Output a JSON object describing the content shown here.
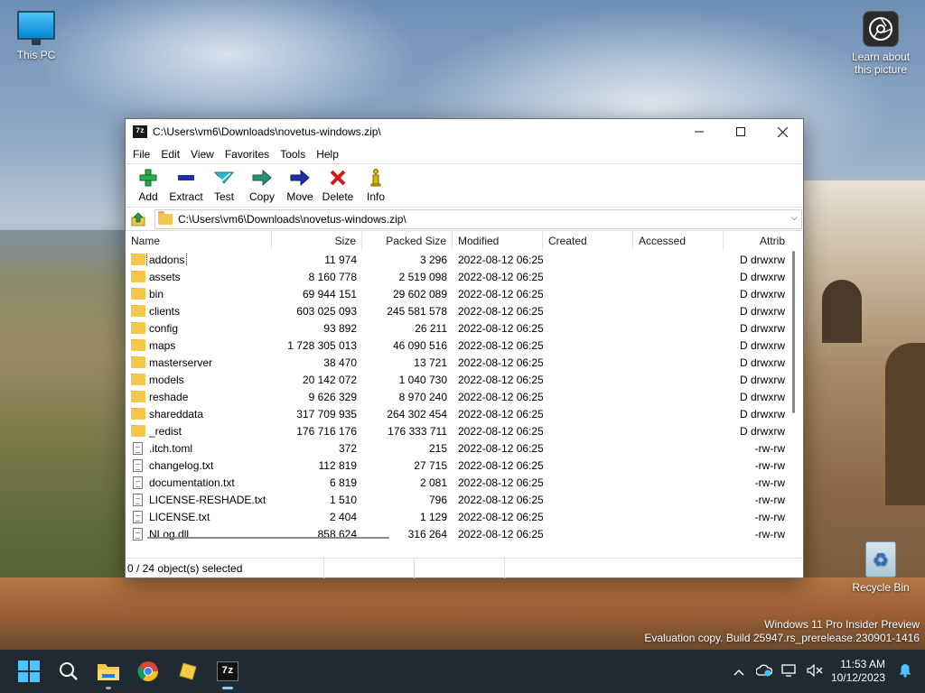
{
  "desktop": {
    "icons": {
      "this_pc": "This PC",
      "learn": "Learn about this picture",
      "recycle": "Recycle Bin"
    },
    "watermark": {
      "line1": "Windows 11 Pro Insider Preview",
      "line2": "Evaluation copy. Build 25947.rs_prerelease.230901-1416"
    }
  },
  "window": {
    "title": "C:\\Users\\vm6\\Downloads\\novetus-windows.zip\\",
    "app_icon_text": "7z",
    "menu": [
      "File",
      "Edit",
      "View",
      "Favorites",
      "Tools",
      "Help"
    ],
    "toolbar": [
      {
        "label": "Add",
        "icon": "add-icon",
        "color": "#22b14c"
      },
      {
        "label": "Extract",
        "icon": "extract-icon",
        "color": "#1d2fa8"
      },
      {
        "label": "Test",
        "icon": "test-icon",
        "color": "#2bb5c8"
      },
      {
        "label": "Copy",
        "icon": "copy-icon",
        "color": "#2b8f7a"
      },
      {
        "label": "Move",
        "icon": "move-icon",
        "color": "#1d2fa8"
      },
      {
        "label": "Delete",
        "icon": "delete-icon",
        "color": "#d01818"
      },
      {
        "label": "Info",
        "icon": "info-icon",
        "color": "#d6b400"
      }
    ],
    "address": "C:\\Users\\vm6\\Downloads\\novetus-windows.zip\\",
    "columns": {
      "name": "Name",
      "size": "Size",
      "packed": "Packed Size",
      "modified": "Modified",
      "created": "Created",
      "accessed": "Accessed",
      "attrib": "Attrib"
    },
    "rows": [
      {
        "name": "addons",
        "type": "folder",
        "size": "11 974",
        "packed": "3 296",
        "modified": "2022-08-12 06:25",
        "created": "",
        "accessed": "",
        "attrib": "D drwxrw"
      },
      {
        "name": "assets",
        "type": "folder",
        "size": "8 160 778",
        "packed": "2 519 098",
        "modified": "2022-08-12 06:25",
        "created": "",
        "accessed": "",
        "attrib": "D drwxrw"
      },
      {
        "name": "bin",
        "type": "folder",
        "size": "69 944 151",
        "packed": "29 602 089",
        "modified": "2022-08-12 06:25",
        "created": "",
        "accessed": "",
        "attrib": "D drwxrw"
      },
      {
        "name": "clients",
        "type": "folder",
        "size": "603 025 093",
        "packed": "245 581 578",
        "modified": "2022-08-12 06:25",
        "created": "",
        "accessed": "",
        "attrib": "D drwxrw"
      },
      {
        "name": "config",
        "type": "folder",
        "size": "93 892",
        "packed": "26 211",
        "modified": "2022-08-12 06:25",
        "created": "",
        "accessed": "",
        "attrib": "D drwxrw"
      },
      {
        "name": "maps",
        "type": "folder",
        "size": "1 728 305 013",
        "packed": "46 090 516",
        "modified": "2022-08-12 06:25",
        "created": "",
        "accessed": "",
        "attrib": "D drwxrw"
      },
      {
        "name": "masterserver",
        "type": "folder",
        "size": "38 470",
        "packed": "13 721",
        "modified": "2022-08-12 06:25",
        "created": "",
        "accessed": "",
        "attrib": "D drwxrw"
      },
      {
        "name": "models",
        "type": "folder",
        "size": "20 142 072",
        "packed": "1 040 730",
        "modified": "2022-08-12 06:25",
        "created": "",
        "accessed": "",
        "attrib": "D drwxrw"
      },
      {
        "name": "reshade",
        "type": "folder",
        "size": "9 626 329",
        "packed": "8 970 240",
        "modified": "2022-08-12 06:25",
        "created": "",
        "accessed": "",
        "attrib": "D drwxrw"
      },
      {
        "name": "shareddata",
        "type": "folder",
        "size": "317 709 935",
        "packed": "264 302 454",
        "modified": "2022-08-12 06:25",
        "created": "",
        "accessed": "",
        "attrib": "D drwxrw"
      },
      {
        "name": "_redist",
        "type": "folder",
        "size": "176 716 176",
        "packed": "176 333 711",
        "modified": "2022-08-12 06:25",
        "created": "",
        "accessed": "",
        "attrib": "D drwxrw"
      },
      {
        "name": ".itch.toml",
        "type": "file",
        "size": "372",
        "packed": "215",
        "modified": "2022-08-12 06:25",
        "created": "",
        "accessed": "",
        "attrib": "-rw-rw"
      },
      {
        "name": "changelog.txt",
        "type": "file",
        "size": "112 819",
        "packed": "27 715",
        "modified": "2022-08-12 06:25",
        "created": "",
        "accessed": "",
        "attrib": "-rw-rw"
      },
      {
        "name": "documentation.txt",
        "type": "file",
        "size": "6 819",
        "packed": "2 081",
        "modified": "2022-08-12 06:25",
        "created": "",
        "accessed": "",
        "attrib": "-rw-rw"
      },
      {
        "name": "LICENSE-RESHADE.txt",
        "type": "file",
        "size": "1 510",
        "packed": "796",
        "modified": "2022-08-12 06:25",
        "created": "",
        "accessed": "",
        "attrib": "-rw-rw"
      },
      {
        "name": "LICENSE.txt",
        "type": "file",
        "size": "2 404",
        "packed": "1 129",
        "modified": "2022-08-12 06:25",
        "created": "",
        "accessed": "",
        "attrib": "-rw-rw"
      },
      {
        "name": "NLog.dll",
        "type": "file",
        "size": "858 624",
        "packed": "316 264",
        "modified": "2022-08-12 06:25",
        "created": "",
        "accessed": "",
        "attrib": "-rw-rw"
      }
    ],
    "status": {
      "selected": "0 / 24 object(s) selected",
      "cell2": "",
      "cell3": "",
      "cell4": ""
    }
  },
  "taskbar": {
    "apps": [
      "start-icon",
      "search-icon",
      "file-explorer-icon",
      "chrome-icon",
      "sticky-notes-icon",
      "7zip-icon"
    ],
    "app_7z_text": "7z",
    "time": "11:53 AM",
    "date": "10/12/2023"
  }
}
